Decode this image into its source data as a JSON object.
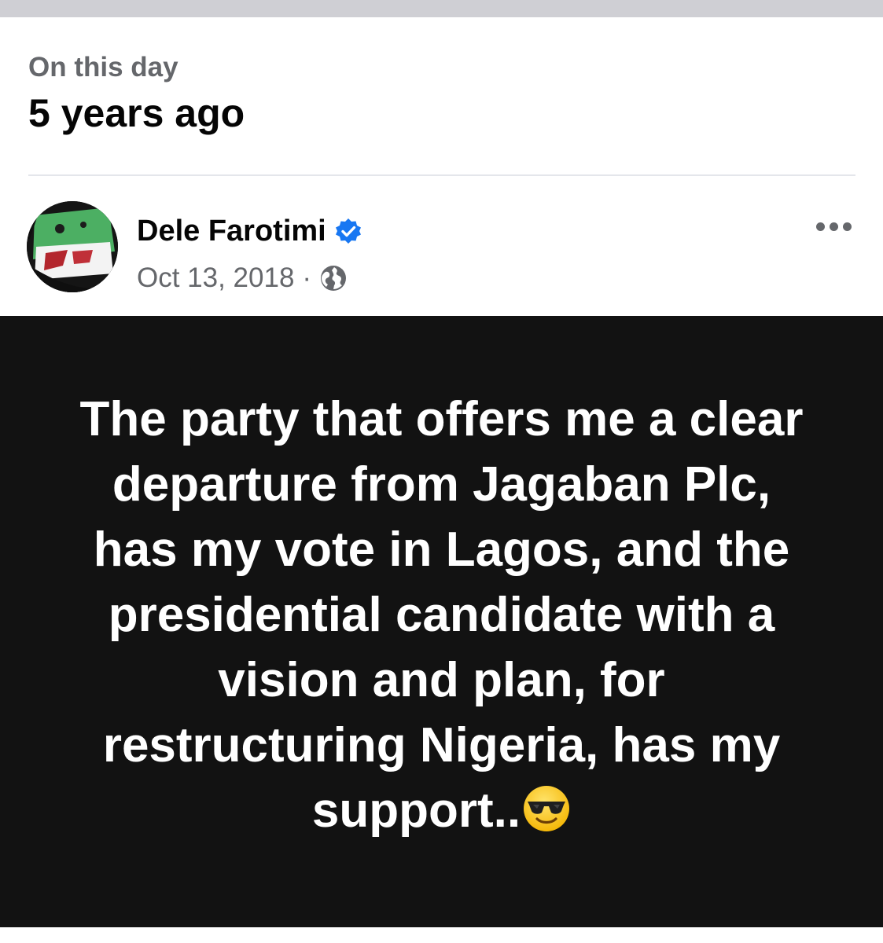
{
  "memory": {
    "kicker": "On this day",
    "title": "5 years ago"
  },
  "post": {
    "author": "Dele Farotimi",
    "verified": true,
    "date": "Oct 13, 2018",
    "separator": "·",
    "audience_icon": "globe-icon",
    "more_icon": "more-options-icon",
    "background_color": "#121212",
    "text_color": "#ffffff",
    "text": "The party that offers me a clear departure from Jagaban Plc, has my vote in Lagos, and the presidential candidate with a vision and plan, for restructuring Nigeria, has my support..",
    "emoji": "smiling-face-with-sunglasses-icon"
  },
  "colors": {
    "verified_badge": "#1877f2",
    "secondary_text": "#65676b",
    "primary_text": "#050505"
  }
}
